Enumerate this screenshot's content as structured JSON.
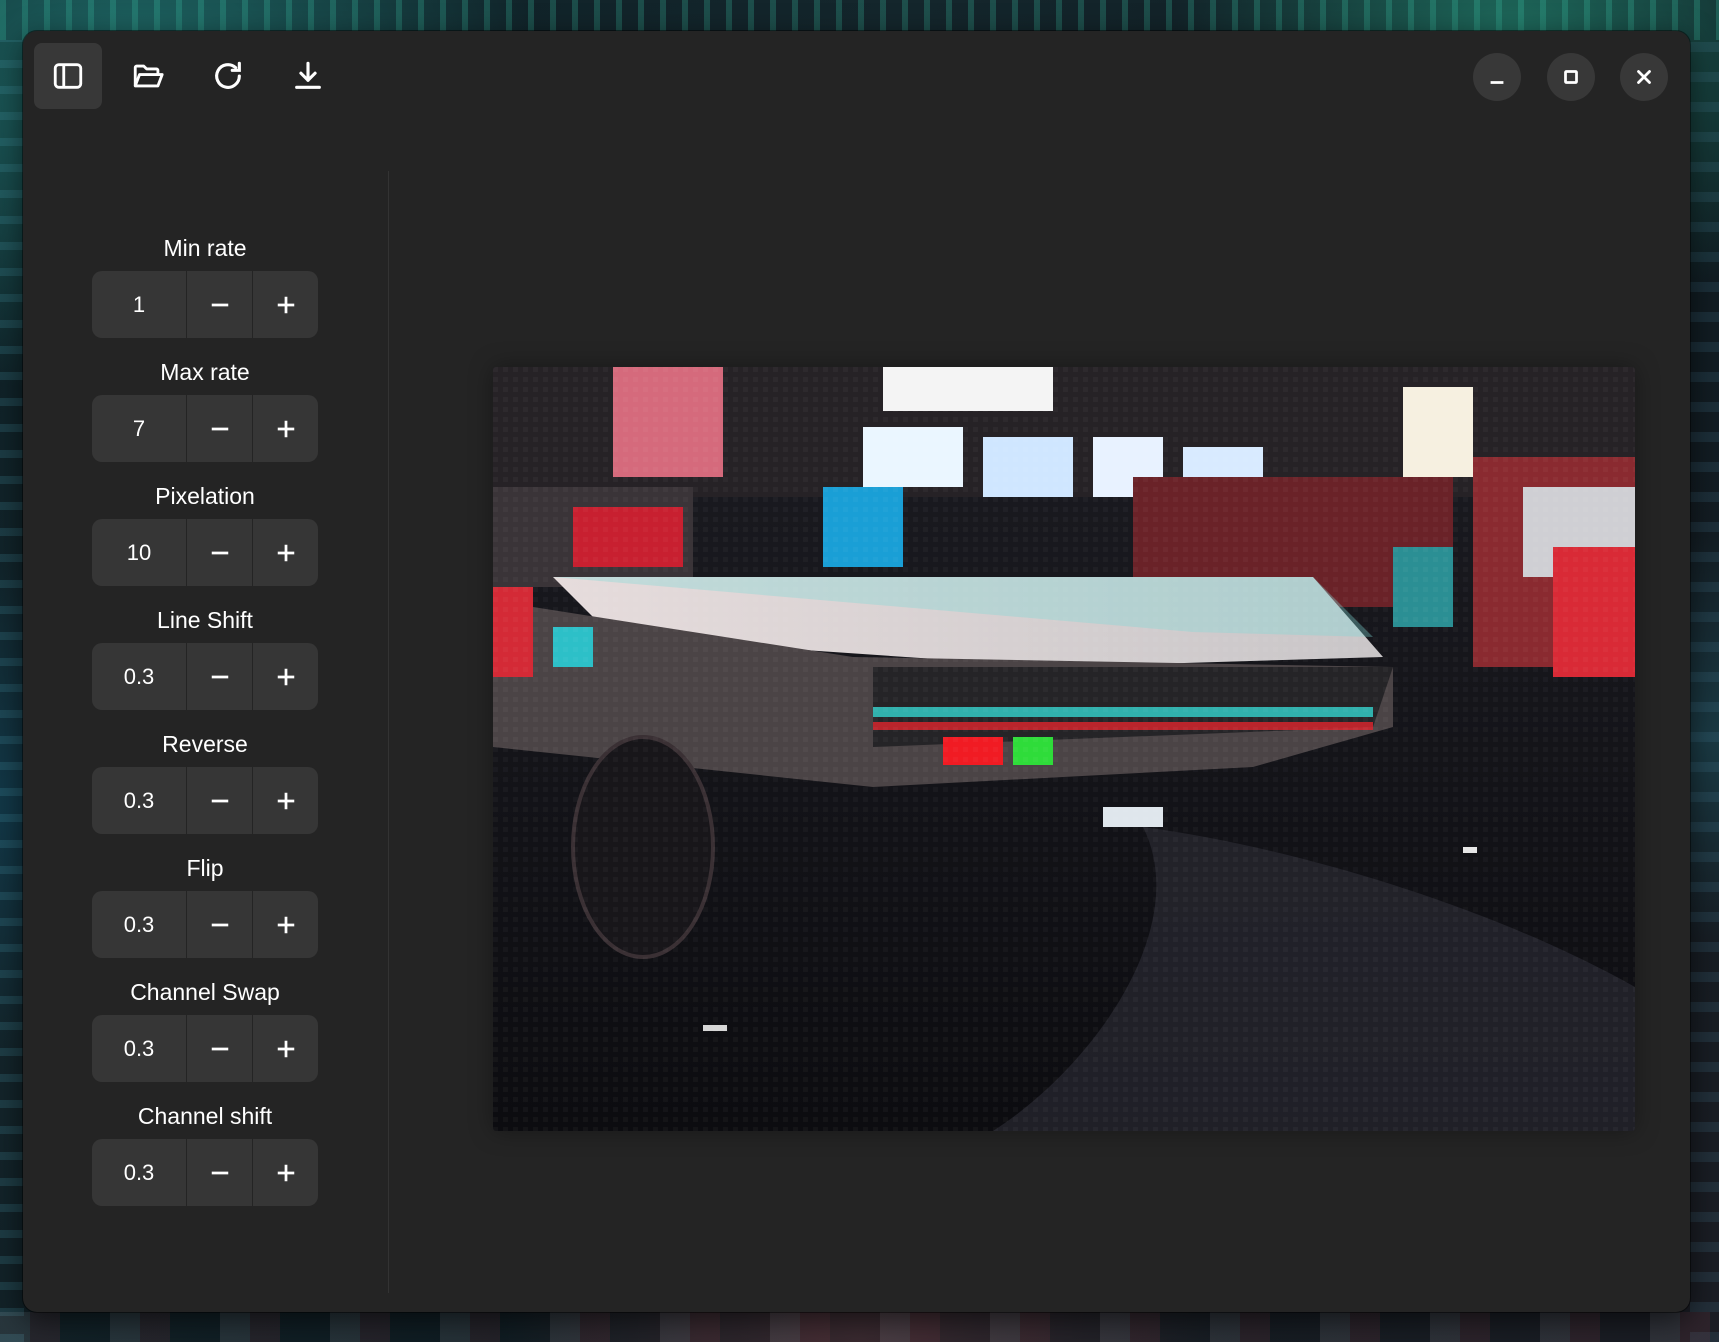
{
  "toolbar": {
    "buttons": [
      {
        "name": "sidebar-toggle",
        "icon": "sidebar-icon",
        "active": true
      },
      {
        "name": "open",
        "icon": "folder-open-icon",
        "active": false
      },
      {
        "name": "refresh",
        "icon": "refresh-icon",
        "active": false
      },
      {
        "name": "download",
        "icon": "download-icon",
        "active": false
      }
    ]
  },
  "window_controls": [
    "minimize-icon",
    "maximize-icon",
    "close-icon"
  ],
  "params": [
    {
      "label": "Min rate",
      "value": "1"
    },
    {
      "label": "Max rate",
      "value": "7"
    },
    {
      "label": "Pixelation",
      "value": "10"
    },
    {
      "label": "Line Shift",
      "value": "0.3"
    },
    {
      "label": "Reverse",
      "value": "0.3"
    },
    {
      "label": "Flip",
      "value": "0.3"
    },
    {
      "label": "Channel Swap",
      "value": "0.3"
    },
    {
      "label": "Channel shift",
      "value": "0.3"
    }
  ],
  "colors": {
    "window_bg": "#242424",
    "control_bg": "#363636",
    "active_button_bg": "#383838",
    "text": "#ffffff"
  }
}
